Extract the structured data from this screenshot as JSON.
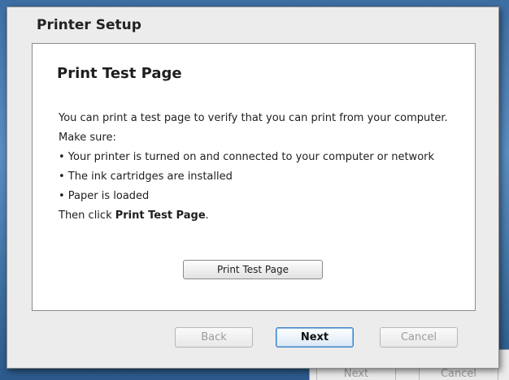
{
  "background_window": {
    "next_label": "Next",
    "cancel_label": "Cancel"
  },
  "dialog": {
    "title": "Printer Setup",
    "heading": "Print Test Page",
    "intro": "You can print a test page to verify that you can print from your computer.",
    "make_sure": "Make sure:",
    "checklist": [
      "• Your printer is turned on and connected to your computer or network",
      "• The ink cartridges are installed",
      "• Paper is loaded"
    ],
    "then_click_prefix": "Then click ",
    "then_click_bold": "Print Test Page",
    "then_click_suffix": ".",
    "print_button_label": "Print Test Page",
    "buttons": {
      "back": "Back",
      "next": "Next",
      "cancel": "Cancel"
    }
  }
}
